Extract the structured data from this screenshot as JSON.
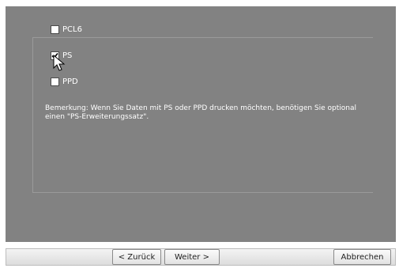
{
  "options": [
    {
      "label": "PCL6",
      "checked": false
    },
    {
      "label": "PS",
      "checked": true
    },
    {
      "label": "PPD",
      "checked": false
    }
  ],
  "note": "Bemerkung: Wenn Sie Daten mit PS oder PPD drucken möchten, benötigen Sie optional einen \"PS-Erweiterungssatz\".",
  "buttons": {
    "back": "< Zurück",
    "next": "Weiter >",
    "cancel": "Abbrechen"
  },
  "colors": {
    "panel": "#828282",
    "text": "#ffffff"
  }
}
